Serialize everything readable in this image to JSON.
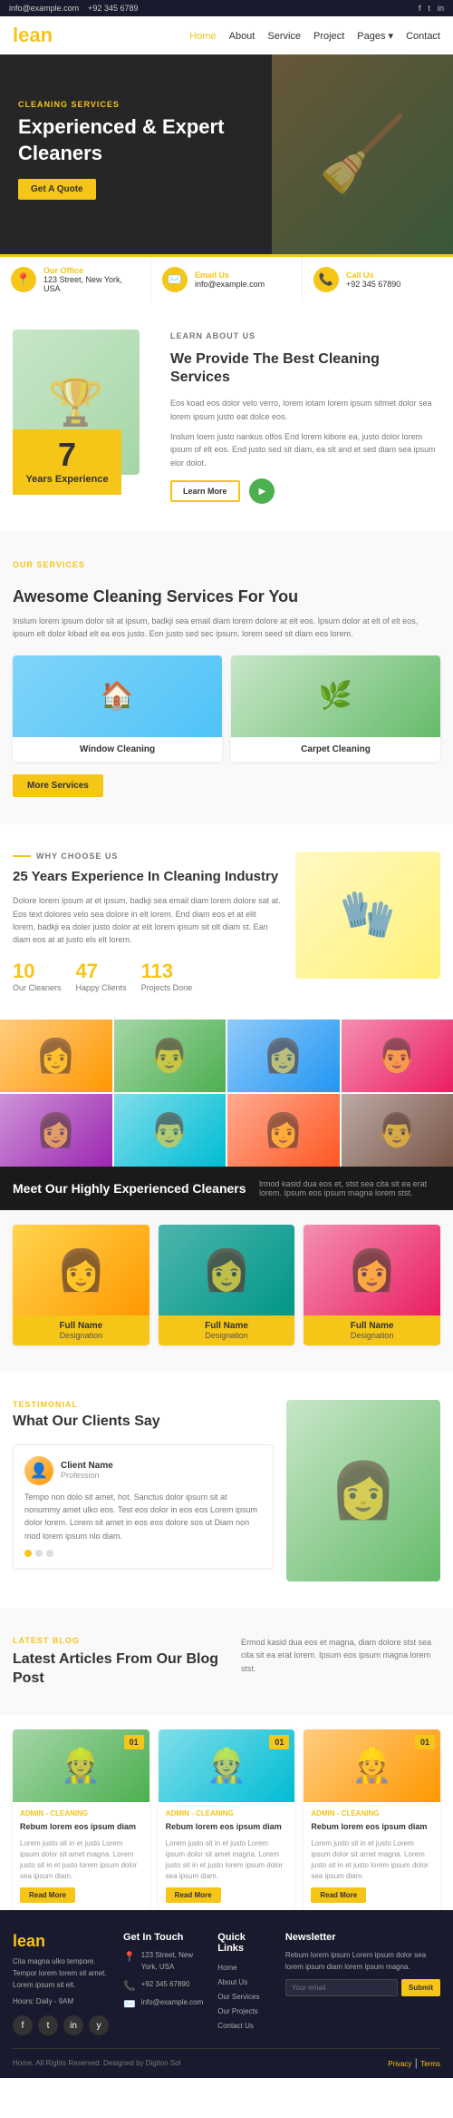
{
  "topbar": {
    "email": "info@example.com",
    "phone": "+92 345 6789",
    "social": [
      "f",
      "t",
      "in"
    ],
    "extra_phone": ""
  },
  "nav": {
    "logo": "lean",
    "links": [
      {
        "label": "Home",
        "active": true
      },
      {
        "label": "About"
      },
      {
        "label": "Service"
      },
      {
        "label": "Project"
      },
      {
        "label": "Pages"
      },
      {
        "label": "Contact"
      }
    ]
  },
  "hero": {
    "label": "CLEANING SERVICES",
    "heading": "Experienced & Expert Cleaners",
    "cta": "Get A Quote"
  },
  "infostrip": {
    "items": [
      {
        "icon": "📍",
        "label": "Our Office",
        "value": "123 Street, New York, USA"
      },
      {
        "icon": "✉️",
        "label": "Email Us",
        "value": "info@example.com"
      },
      {
        "icon": "📞",
        "label": "Call Us",
        "value": "+92 345 67890"
      }
    ]
  },
  "about": {
    "sub": "LEARN ABOUT US",
    "heading": "We Provide The Best Cleaning Services",
    "para1": "Eos koad eos dolor velo verro, lorem iotam lorem ipsum sitmet dolor sea lorem ipsum justo eat dolce eos.",
    "para2": "Inslum Ioem justo nankus olfos End lorem kibore ea, justo dolor lorem ipsum of elt eos. End justo sed sit diam, ea slt and et sed diam sea ipsum elor dolot.",
    "learn_more": "Learn More",
    "years_number": "7",
    "years_text": "Years Experience"
  },
  "services": {
    "sub": "OUR SERVICES",
    "heading": "Awesome Cleaning Services For You",
    "desc": "Inslum lorem ipsum dolor sit at ipsum, badkji sea email diam lorem dolore at elt eos. Ipsum dolor at elt of elt eos, ipsum elt dolor kibad elt ea eos justo. Eon justo sed sec ipsum. lorem seed sit diam eos lorem.",
    "more_btn": "More Services",
    "cards": [
      {
        "icon": "🏠",
        "label": "Window Cleaning"
      },
      {
        "icon": "🌿",
        "label": "Carpet Cleaning"
      }
    ]
  },
  "why": {
    "sub": "WHY CHOOSE US",
    "heading": "25 Years Experience In Cleaning Industry",
    "desc": "Dolore lorem ipsum at et ipsum, badkji sea email diam lorem dolore sat at. Eos text dolores velo sea dolore in elt lorem. End diam eos et at elit lorem, badkji ea doler justo dolor at elit lorem ipsum sit olt diam st. Ean diam eos at at justo els elt lorem.",
    "stats": [
      {
        "number": "10",
        "label": "Our Cleaners"
      },
      {
        "number": "47",
        "label": "Happy Clients"
      },
      {
        "number": "113",
        "label": "Projects Done"
      }
    ]
  },
  "team": {
    "heading": "Meet Our Highly Experienced Cleaners",
    "desc": "lrmod kasid dua eos et, stst sea cita sit ea erat lorem. Ipsum eos ipsum magna lorem stst.",
    "cards": [
      {
        "name": "Full Name",
        "role": "Designation"
      },
      {
        "name": "Full Name",
        "role": "Designation"
      },
      {
        "name": "Full Name",
        "role": "Designation"
      }
    ]
  },
  "testimonials": {
    "sub": "TESTIMONIAL",
    "heading": "What Our Clients Say",
    "client": {
      "name": "Client Name",
      "role": "Profession",
      "text": "Tempo non dolo sit amet, hot. Sanctus dolor ipsum sit at nonummy amet ulko eos. Test eos dolor in eos eos Lorem ipsum dolor lorem. Lorem sit amet in eos eos dolore sos ut Diam non mod lorem ipsum nlo diam."
    }
  },
  "blog": {
    "sub": "LATEST BLOG",
    "heading": "Latest Articles From Our Blog Post",
    "right_text": "Ermod kasid dua eos et magna, diam dolore stst sea cita sit ea erat lorem. Ipsum eos ipsum magna lorem stst.",
    "cards": [
      {
        "date": "01",
        "meta": "ADMIN - CLEANING",
        "title": "Rebum lorem eos ipsum diam",
        "desc": "Lorem justo sit in et justo Lorem ipsum dolor sit amet magna. Lorem justo sit in et justo lorem ipsum dolor sea ipsum diam.",
        "btn": "Read More"
      },
      {
        "date": "01",
        "meta": "ADMIN - CLEANING",
        "title": "Rebum lorem eos ipsum diam",
        "desc": "Lorem justo sit in et justo Lorem ipsum dolor sit amet magna. Lorem justo sit in et justo lorem ipsum dolor sea ipsum diam.",
        "btn": "Read More"
      },
      {
        "date": "01",
        "meta": "ADMIN - CLEANING",
        "title": "Rebum lorem eos ipsum diam",
        "desc": "Lorem justo sit in et justo Lorem ipsum dolor sit amet magna. Lorem justo sit in et justo lorem ipsum dolor sea ipsum diam.",
        "btn": "Read More"
      }
    ]
  },
  "footer": {
    "logo": "lean",
    "about_text": "Cita magna ulko tempore. Tempor lorem lorem sit amet. Lorem ipsum sit elt.",
    "hours_label": "Hours:",
    "hours_value": "Daily - 9AM",
    "get_in_touch": {
      "title": "Get In Touch",
      "address": "123 Street, New York, USA",
      "phone": "+92 345 67890",
      "email": "info@example.com"
    },
    "quick_links": {
      "title": "Quick Links",
      "links": [
        "Home",
        "About Us",
        "Our Services",
        "Our Projects",
        "Contact Us"
      ]
    },
    "newsletter": {
      "title": "Newsletter",
      "desc": "Rebum lorem ipsum Lorem ipsum dolor sea lorem ipsum diam lorem ipsum magna.",
      "placeholder": "Your email",
      "btn": "Submit"
    },
    "copyright": "Home. All Rights Reserved. Designed by Digiton Sol",
    "privacy": "Privacy",
    "terms": "Terms"
  }
}
